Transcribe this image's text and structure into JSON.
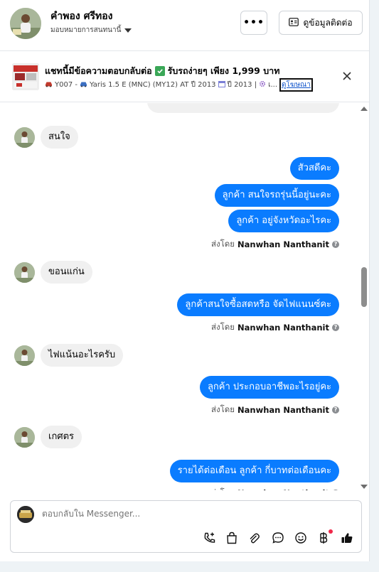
{
  "header": {
    "name": "คำพอง ศรีทอง",
    "subtitle": "มอบหมายการสนทนานี้",
    "more_label": "•••",
    "contact_button": "ดูข้อมูลติดต่อ"
  },
  "ad": {
    "title": "แชทนี้มีข้อความตอบกลับต่อ",
    "title_suffix": "รับรถง่ายๆ เพียง 1,999 บาท",
    "sub_prefix": "Y007 -",
    "sub_model": "Yaris 1.5 E (MNC) (MY12) AT ปี 2013",
    "sub_year": "ปี 2013 |",
    "sub_more": "เ...",
    "link": "ดูโฆษณา"
  },
  "messages": [
    {
      "dir": "in",
      "text": "สนใจ"
    },
    {
      "dir": "out",
      "text": "สัวสดีคะ"
    },
    {
      "dir": "out",
      "text": "ลูกค้า  สนใจรถรุ่นนี้อยู่นะคะ"
    },
    {
      "dir": "out",
      "text": "ลูกค้า อยู่จังหวัดอะไรคะ"
    },
    {
      "dir": "in",
      "text": "ขอนแก่น"
    },
    {
      "dir": "out",
      "text": "ลูกค้าสนใจซื้อสดหรือ จัดไฟแนนซ์คะ"
    },
    {
      "dir": "in",
      "text": "ไฟแน้นอะไรครับ"
    },
    {
      "dir": "out",
      "text": "ลูกค้า ประกอบอาชีพอะไรอยู่คะ"
    },
    {
      "dir": "in",
      "text": "เกศตร"
    },
    {
      "dir": "out",
      "text": "รายได้ต่อเดือน ลูกค้า กี่บาทต่อเดือนคะ"
    }
  ],
  "sent_by": {
    "prefix": "ส่งโดย",
    "name": "Nanwhan Nanthanit"
  },
  "composer": {
    "placeholder": "ตอบกลับใน Messenger..."
  },
  "colors": {
    "accent": "#0a7cff",
    "incoming_bubble": "#f0f0f0"
  },
  "icons": [
    "phone-add-icon",
    "shopping-bag-icon",
    "attachment-icon",
    "chat-bubble-icon",
    "emoji-icon",
    "baht-icon",
    "thumbs-up-icon"
  ]
}
